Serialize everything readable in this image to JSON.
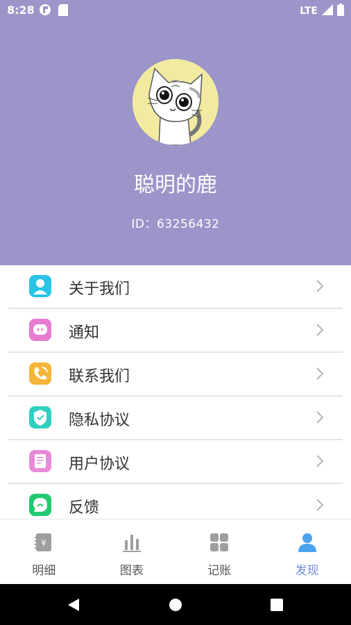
{
  "status_bar": {
    "time": "8:28",
    "network": "LTE"
  },
  "profile": {
    "username": "聪明的鹿",
    "id_text": "ID：63256432"
  },
  "menu": {
    "items": [
      {
        "label": "关于我们",
        "icon": "person-icon",
        "color": "#29c4e6"
      },
      {
        "label": "通知",
        "icon": "chat-bubble-icon",
        "color": "#e77bd0"
      },
      {
        "label": "联系我们",
        "icon": "phone-icon",
        "color": "#f5b53a"
      },
      {
        "label": "隐私协议",
        "icon": "shield-check-icon",
        "color": "#31cfc2"
      },
      {
        "label": "用户协议",
        "icon": "document-icon",
        "color": "#e78ad6"
      },
      {
        "label": "反馈",
        "icon": "feedback-icon",
        "color": "#22c970"
      }
    ]
  },
  "tabs": [
    {
      "label": "明细",
      "icon": "ledger-icon"
    },
    {
      "label": "图表",
      "icon": "bar-chart-icon"
    },
    {
      "label": "记账",
      "icon": "grid-icon"
    },
    {
      "label": "发现",
      "icon": "user-icon"
    }
  ],
  "colors": {
    "header_bg": "#9b95c9",
    "active_tab": "#6f8bd6"
  }
}
